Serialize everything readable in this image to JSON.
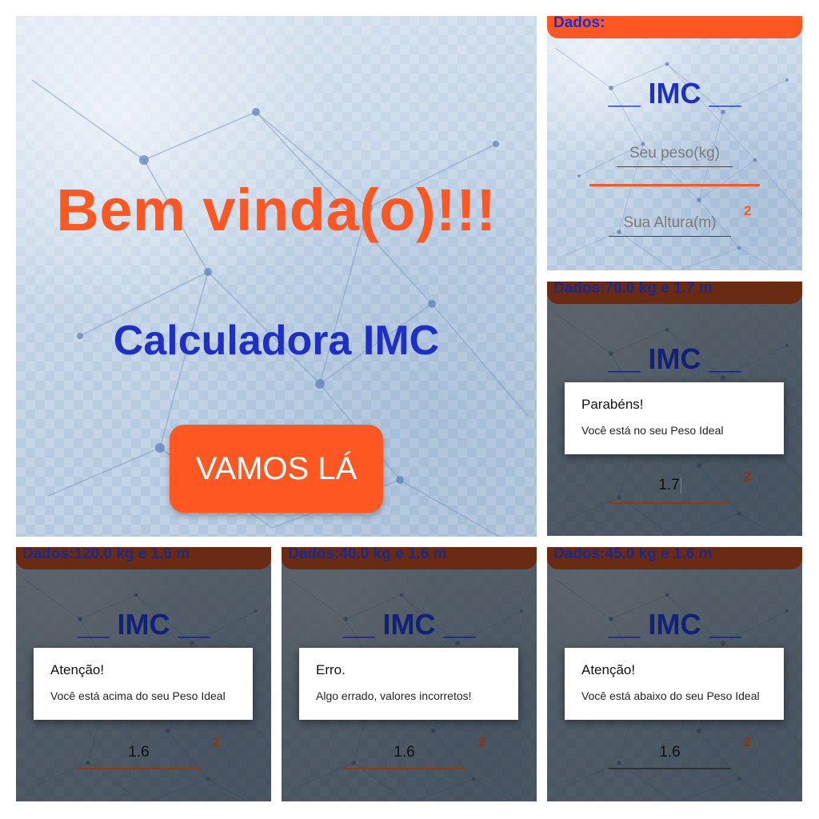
{
  "welcome": {
    "title": "Bem vinda(o)!!!",
    "subtitle": "Calculadora IMC",
    "button_label": "VAMOS LÁ"
  },
  "form": {
    "dados_label": "Dados:",
    "imc_title": "__ IMC __",
    "weight_placeholder": "Seu peso(kg)",
    "height_placeholder": "Sua Altura(m)",
    "superscript": "2"
  },
  "result_ideal": {
    "dados_label": "Dados:70.0 kg e 1.7 m",
    "imc_title": "__ IMC __",
    "dialog_title": "Parabéns!",
    "dialog_message": "Você está no seu Peso Ideal",
    "height_value": "1.7",
    "superscript": "2"
  },
  "result_above": {
    "dados_label": "Dados:120.0 kg e 1.6 m",
    "imc_title": "__ IMC __",
    "dialog_title": "Atenção!",
    "dialog_message": "Você está acima do seu Peso Ideal",
    "height_value": "1.6",
    "superscript": "2"
  },
  "result_error": {
    "dados_label": "Dados:40.0 kg e 1.6 m",
    "imc_title": "__ IMC __",
    "dialog_title": "Erro.",
    "dialog_message": "Algo errado, valores incorretos!",
    "height_value": "1.6",
    "superscript": "2"
  },
  "result_below": {
    "dados_label": "Dados:45.0 kg e 1.6 m",
    "imc_title": "__ IMC __",
    "dialog_title": "Atenção!",
    "dialog_message": "Você está abaixo do seu Peso Ideal",
    "height_value": "1.6",
    "superscript": "2"
  },
  "colors": {
    "accent_orange": "#ff5722",
    "title_blue": "#1e2fc8",
    "background_blue": "#c9d9ea"
  }
}
